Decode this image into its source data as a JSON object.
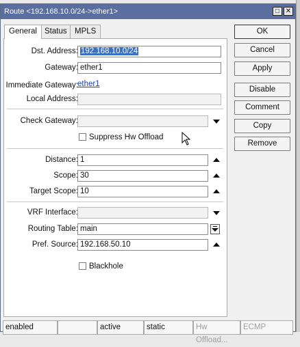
{
  "window": {
    "title": "Route <192.168.10.0/24->ether1>"
  },
  "tabs": [
    {
      "label": "General"
    },
    {
      "label": "Status"
    },
    {
      "label": "MPLS"
    }
  ],
  "form": {
    "dst_address": {
      "label": "Dst. Address:",
      "value": "192.168.10.0/24"
    },
    "gateway": {
      "label": "Gateway:",
      "value": "ether1"
    },
    "immediate_gateway": {
      "label": "Immediate Gateway:",
      "value": "ether1"
    },
    "local_address": {
      "label": "Local Address:",
      "value": ""
    },
    "check_gateway": {
      "label": "Check Gateway:",
      "value": ""
    },
    "suppress_hw_offload": {
      "label": "Suppress Hw Offload",
      "checked": false
    },
    "distance": {
      "label": "Distance:",
      "value": "1"
    },
    "scope": {
      "label": "Scope:",
      "value": "30"
    },
    "target_scope": {
      "label": "Target Scope:",
      "value": "10"
    },
    "vrf_interface": {
      "label": "VRF Interface:",
      "value": ""
    },
    "routing_table": {
      "label": "Routing Table:",
      "value": "main"
    },
    "pref_source": {
      "label": "Pref. Source:",
      "value": "192.168.50.10"
    },
    "blackhole": {
      "label": "Blackhole",
      "checked": false
    }
  },
  "buttons": {
    "ok": "OK",
    "cancel": "Cancel",
    "apply": "Apply",
    "disable": "Disable",
    "comment": "Comment",
    "copy": "Copy",
    "remove": "Remove"
  },
  "status_bar": [
    {
      "text": "enabled"
    },
    {
      "text": ""
    },
    {
      "text": "active"
    },
    {
      "text": "static"
    },
    {
      "text": "Hw Offload..."
    },
    {
      "text": "ECMP"
    }
  ]
}
